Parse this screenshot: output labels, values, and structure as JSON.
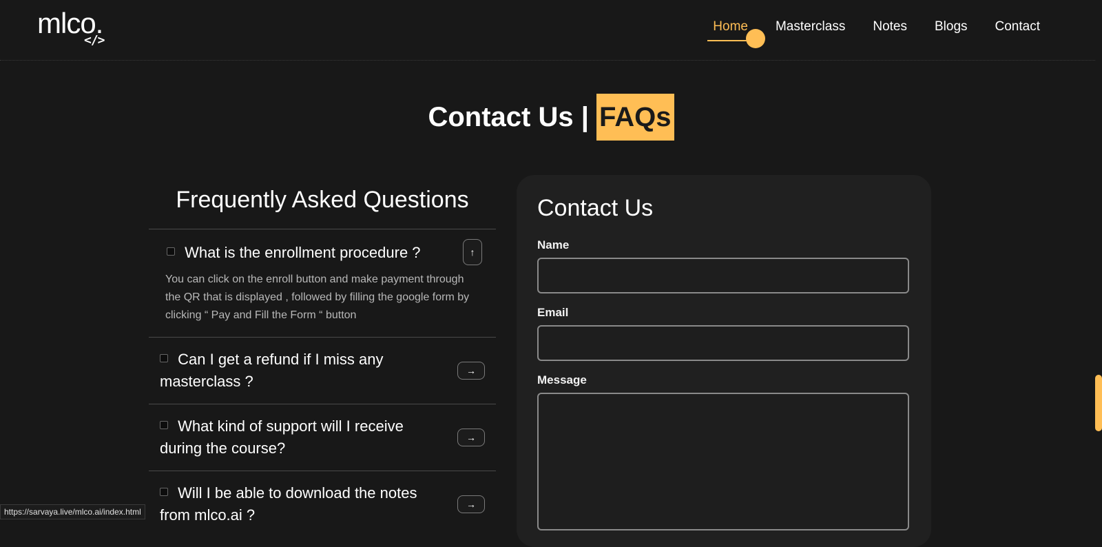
{
  "brand": {
    "logo_text": "mlco.",
    "logo_code": "</>"
  },
  "nav": {
    "items": [
      {
        "label": "Home",
        "active": true
      },
      {
        "label": "Masterclass",
        "active": false
      },
      {
        "label": "Notes",
        "active": false
      },
      {
        "label": "Blogs",
        "active": false
      },
      {
        "label": "Contact",
        "active": false
      }
    ]
  },
  "title": {
    "main": "Contact Us |",
    "highlight": "FAQs"
  },
  "faq": {
    "heading": "Frequently Asked Questions",
    "items": [
      {
        "question": "What is the enrollment procedure ?",
        "answer": "You can click on the enroll button and make payment through the QR that is displayed , followed by filling the google form by clicking “ Pay and Fill the Form “ button",
        "expanded": true,
        "toggle_icon": "arrow-up-icon"
      },
      {
        "question": "Can I get a refund if I miss any masterclass ?",
        "expanded": false,
        "toggle_icon": "arrow-right-icon"
      },
      {
        "question": "What kind of support will I receive during the course?",
        "expanded": false,
        "toggle_icon": "arrow-right-icon"
      },
      {
        "question": "Will I be able to download the notes from mlco.ai ?",
        "expanded": false,
        "toggle_icon": "arrow-right-icon"
      }
    ]
  },
  "contact": {
    "title": "Contact Us",
    "name_label": "Name",
    "email_label": "Email",
    "message_label": "Message"
  },
  "status_bar": {
    "url": "https://sarvaya.live/mlco.ai/index.html"
  },
  "colors": {
    "accent": "#ffbe55",
    "background": "#181818",
    "card": "#202020"
  }
}
